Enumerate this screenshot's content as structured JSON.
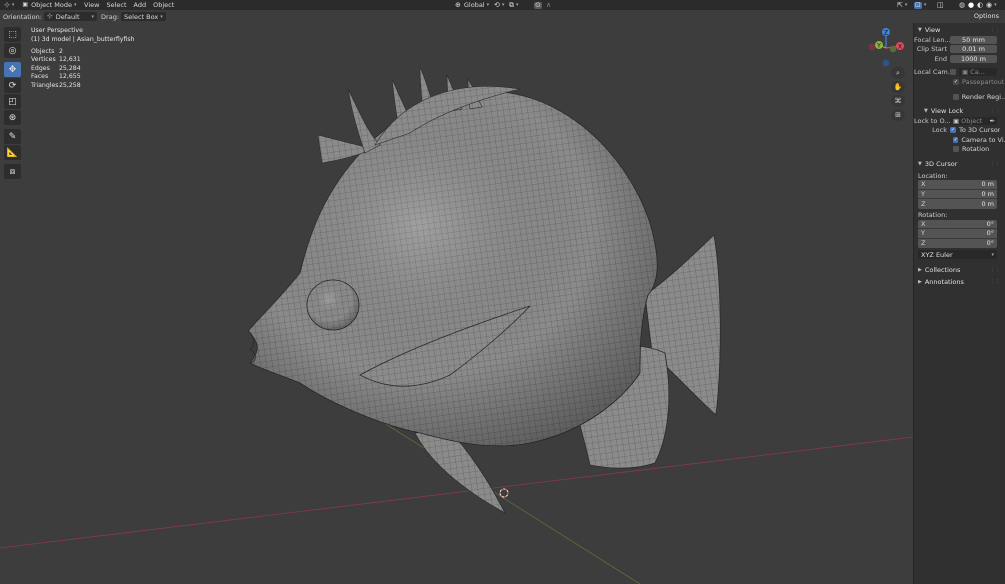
{
  "header": {
    "mode": "Object Mode",
    "menus": [
      "View",
      "Select",
      "Add",
      "Object"
    ],
    "transform_orientation": "Global"
  },
  "tool_settings": {
    "orientation_label": "Orientation:",
    "orientation_value": "Default",
    "drag_label": "Drag:",
    "drag_value": "Select Box"
  },
  "viewport": {
    "perspective": "User Perspective",
    "object_line": "(1) 3d model | Asian_butterflyfish",
    "stats": [
      {
        "key": "Objects",
        "value": "2"
      },
      {
        "key": "Vertices",
        "value": "12,631"
      },
      {
        "key": "Edges",
        "value": "25,284"
      },
      {
        "key": "Faces",
        "value": "12,655"
      },
      {
        "key": "Triangles",
        "value": "25,258"
      }
    ],
    "gizmo": {
      "x": "X",
      "y": "Y",
      "z": "Z"
    }
  },
  "sidebar": {
    "options_label": "Options",
    "view": {
      "title": "View",
      "focal_label": "Focal Len...",
      "focal_value": "50 mm",
      "clip_start_label": "Clip Start",
      "clip_start_value": "0.01 m",
      "end_label": "End",
      "end_value": "1000 m",
      "local_camera_label": "Local Cam...",
      "local_camera_value": "Ca...",
      "passepartout": "Passepartout",
      "render_region": "Render Regi..."
    },
    "view_lock": {
      "title": "View Lock",
      "lock_to_label": "Lock to O...",
      "lock_to_value": "Object",
      "lock_label": "Lock",
      "to_3d_cursor": "To 3D Cursor",
      "camera_to_view": "Camera to Vi...",
      "rotation": "Rotation"
    },
    "cursor": {
      "title": "3D Cursor",
      "location_label": "Location:",
      "location": [
        {
          "axis": "X",
          "value": "0 m"
        },
        {
          "axis": "Y",
          "value": "0 m"
        },
        {
          "axis": "Z",
          "value": "0 m"
        }
      ],
      "rotation_label": "Rotation:",
      "rotation": [
        {
          "axis": "X",
          "value": "0°"
        },
        {
          "axis": "Y",
          "value": "0°"
        },
        {
          "axis": "Z",
          "value": "0°"
        }
      ],
      "rotation_mode": "XYZ Euler"
    },
    "collections": "Collections",
    "annotations": "Annotations"
  },
  "colors": {
    "active_tool": "#4772b3",
    "x_axis": "#e04a5f",
    "y_axis": "#8bb33b",
    "z_axis": "#3d84e0"
  }
}
